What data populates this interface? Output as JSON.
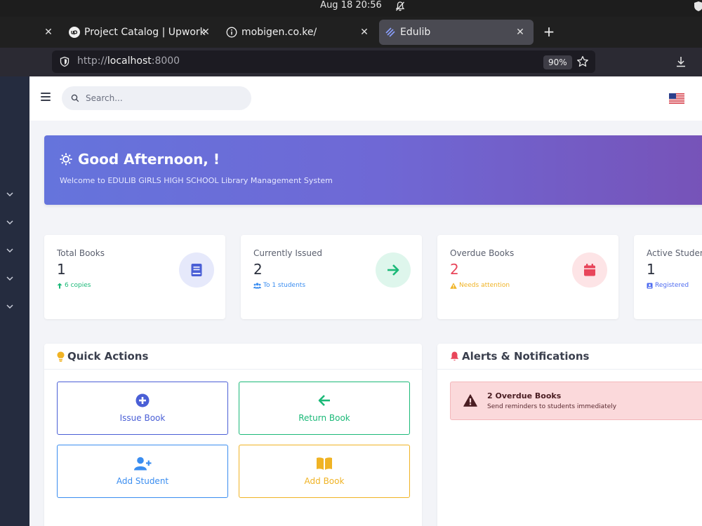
{
  "os": {
    "clock": "Aug 18  20:56"
  },
  "browser": {
    "tabs": [
      {
        "label": "",
        "active": false
      },
      {
        "label": "Project Catalog | Upwork",
        "active": false
      },
      {
        "label": "mobigen.co.ke/",
        "active": false
      },
      {
        "label": "Edulib",
        "active": true
      }
    ],
    "url": {
      "prefix": "http://",
      "host": "localhost",
      "port": ":8000"
    },
    "zoom": "90%"
  },
  "topnav": {
    "search_placeholder": "Search..."
  },
  "hero": {
    "title": "Good Afternoon, !",
    "subtitle": "Welcome to EDULIB GIRLS HIGH SCHOOL Library Management System"
  },
  "stats": [
    {
      "label": "Total Books",
      "value": "1",
      "note": "6 copies",
      "color": "#1bb978"
    },
    {
      "label": "Currently Issued",
      "value": "2",
      "note": "To 1 students",
      "color": "#3a8df0"
    },
    {
      "label": "Overdue Books",
      "value": "2",
      "note": "Needs attention",
      "color": "#f0b324"
    },
    {
      "label": "Active Studen",
      "value": "1",
      "note": "Registered",
      "color": "#4f6cf0"
    }
  ],
  "quick_actions": {
    "title": "Quick Actions",
    "buttons": [
      {
        "label": "Issue Book",
        "color": "#4a5fd6"
      },
      {
        "label": "Return Book",
        "color": "#1bb978"
      },
      {
        "label": "Add Student",
        "color": "#3a8df0"
      },
      {
        "label": "Add Book",
        "color": "#f0b324"
      }
    ]
  },
  "alerts": {
    "title": "Alerts & Notifications",
    "items": [
      {
        "title": "2 Overdue Books",
        "subtitle": "Send reminders to students immediately"
      }
    ]
  }
}
